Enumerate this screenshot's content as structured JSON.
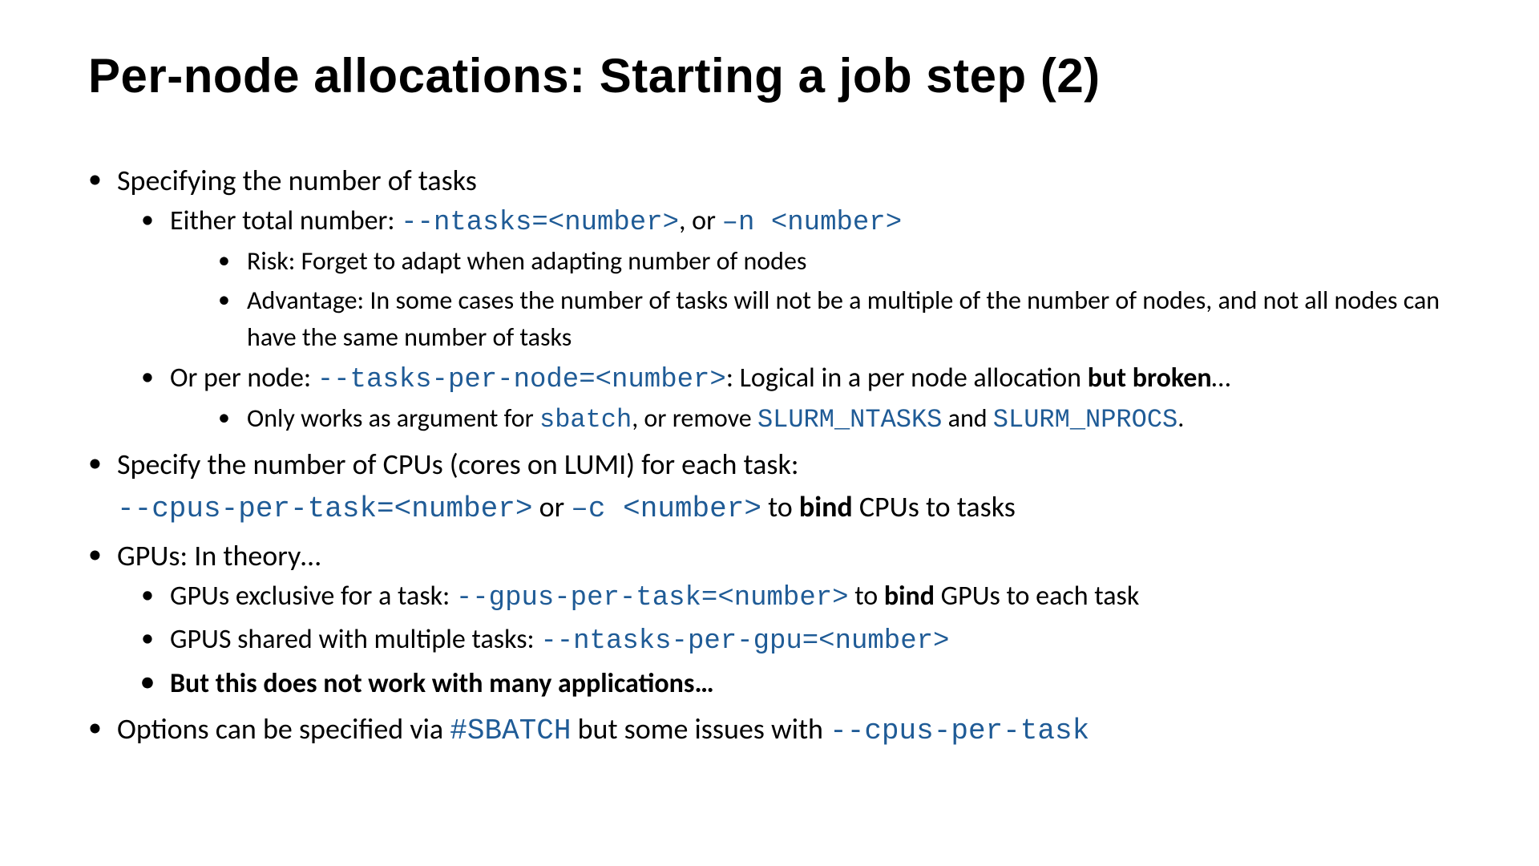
{
  "title": "Per-node allocations: Starting a job step (2)",
  "b1": {
    "text": "Specifying the number of tasks",
    "s1": {
      "pre": "Either total number: ",
      "c1": "--ntasks=<number>",
      "mid": ", or ",
      "c2": "–n <number>",
      "t1": "Risk: Forget to adapt when adapting number of nodes",
      "t2": "Advantage: In some cases the number of tasks will not be a multiple of the number of nodes, and not all nodes can have the same number of tasks"
    },
    "s2": {
      "pre": "Or per node: ",
      "c1": "--tasks-per-node=<number>",
      "mid": ": Logical in a per node allocation ",
      "bold": "but broken",
      "post": "…",
      "t1pre": "Only works as argument for ",
      "t1c1": "sbatch",
      "t1mid": ", or remove ",
      "t1c2": "SLURM_NTASKS",
      "t1and": " and ",
      "t1c3": "SLURM_NPROCS",
      "t1post": "."
    }
  },
  "b2": {
    "l1": "Specify the number of CPUs (cores on LUMI) for each task:",
    "c1": "--cpus-per-task=<number>",
    "mid": " or ",
    "c2": "–c <number>",
    "mid2": " to ",
    "bold": "bind",
    "post": " CPUs to tasks"
  },
  "b3": {
    "text": "GPUs: In theory…",
    "s1": {
      "pre": "GPUs exclusive for a task: ",
      "c1": "--gpus-per-task=<number>",
      "mid": " to ",
      "bold": "bind",
      "post": " GPUs to each task"
    },
    "s2": {
      "pre": "GPUS shared with multiple tasks: ",
      "c1": "--ntasks-per-gpu=<number>"
    },
    "s3": "But this does not work with many applications…"
  },
  "b4": {
    "pre": "Options can be specified via ",
    "c1": "#SBATCH",
    "mid": " but some issues with ",
    "c2": "--cpus-per-task"
  }
}
